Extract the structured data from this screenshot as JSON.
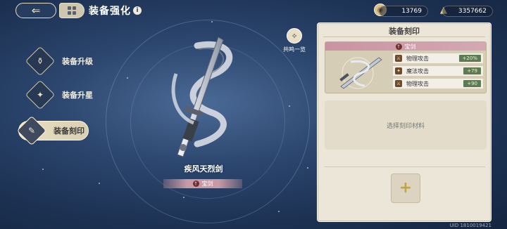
{
  "header": {
    "title": "装备强化",
    "info_icon": "i"
  },
  "currencies": [
    {
      "icon": "coin-icon",
      "value": "13769"
    },
    {
      "icon": "gold-pile-icon",
      "value": "3357662"
    }
  ],
  "nav": {
    "items": [
      {
        "label": "装备升级",
        "icon": "upgrade-icon"
      },
      {
        "label": "装备升星",
        "icon": "star-up-icon"
      },
      {
        "label": "装备刻印",
        "icon": "engrave-icon",
        "active": true
      }
    ]
  },
  "weapon": {
    "name": "疾风天烈剑",
    "tag": "宝剑"
  },
  "resonance": {
    "label": "共鸣一览"
  },
  "panel": {
    "title": "装备刻印",
    "card_tag": "宝剑",
    "stats": [
      {
        "label": "物理攻击",
        "value": "+20%"
      },
      {
        "label": "魔法攻击",
        "value": "+79"
      },
      {
        "label": "物理攻击",
        "value": "+90"
      }
    ],
    "material_prompt": "选择刻印材料",
    "add_symbol": "+"
  },
  "footer": {
    "uid": "UID 1810019421"
  },
  "colors": {
    "background": "#2c466e",
    "panel": "#ece6d8",
    "accent_tag": "#c994a1",
    "stat_value_bg": "#5c7a54"
  }
}
